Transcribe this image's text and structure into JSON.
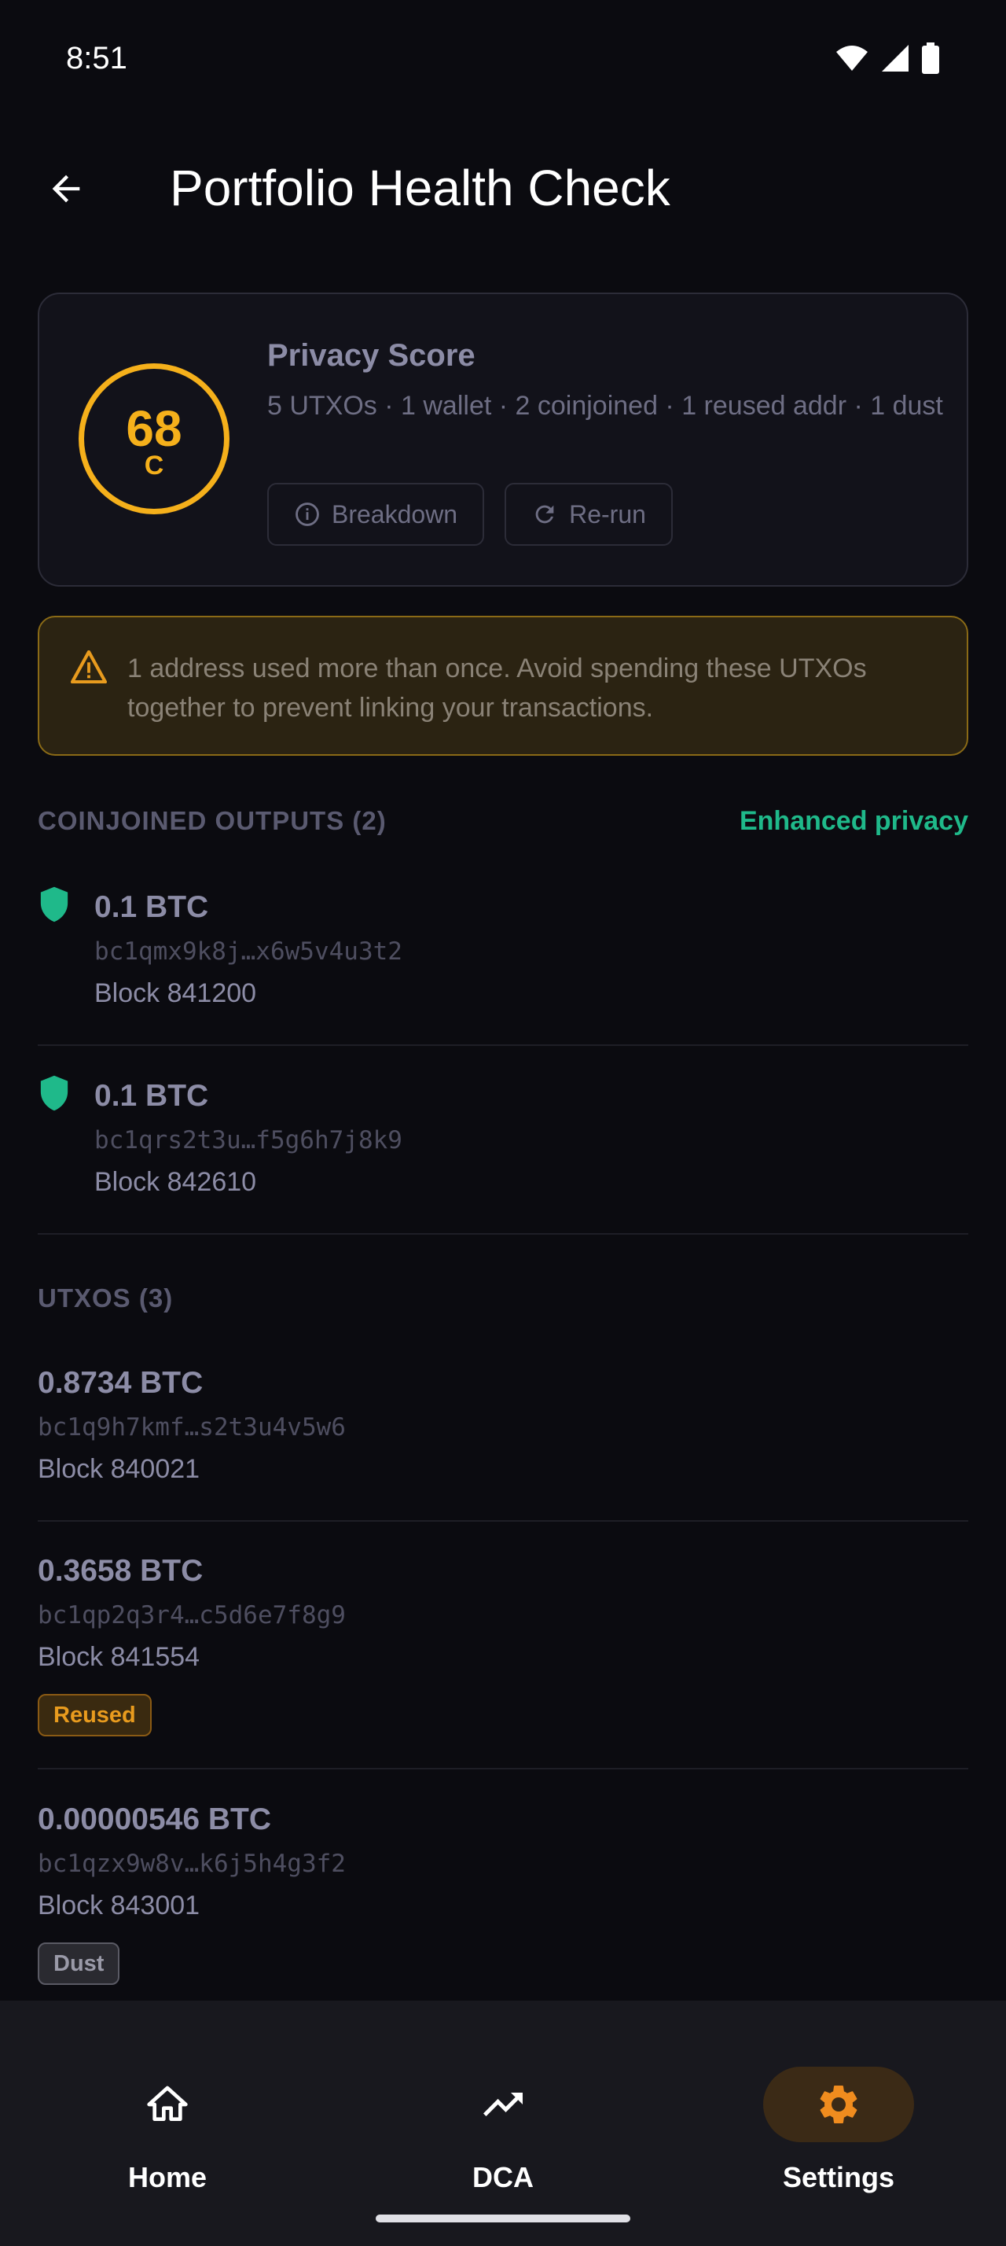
{
  "status_bar": {
    "time": "8:51"
  },
  "app_bar": {
    "title": "Portfolio Health Check"
  },
  "score_card": {
    "score": "68",
    "grade": "C",
    "title": "Privacy Score",
    "summary": "5 UTXOs · 1 wallet · 2 coinjoined · 1 reused addr · 1 dust",
    "breakdown_label": "Breakdown",
    "rerun_label": "Re-run"
  },
  "warning": {
    "text": "1 address used more than once. Avoid spending these UTXOs together to prevent linking your transactions."
  },
  "coinjoined": {
    "title": "COINJOINED OUTPUTS (2)",
    "right_label": "Enhanced privacy",
    "items": [
      {
        "amount": "0.1 BTC",
        "address": "bc1qmx9k8j…x6w5v4u3t2",
        "block": "Block 841200"
      },
      {
        "amount": "0.1 BTC",
        "address": "bc1qrs2t3u…f5g6h7j8k9",
        "block": "Block 842610"
      }
    ]
  },
  "utxos": {
    "title": "UTXOS (3)",
    "items": [
      {
        "amount": "0.8734 BTC",
        "address": "bc1q9h7kmf…s2t3u4v5w6",
        "block": "Block 840021",
        "badge": ""
      },
      {
        "amount": "0.3658 BTC",
        "address": "bc1qp2q3r4…c5d6e7f8g9",
        "block": "Block 841554",
        "badge": "Reused"
      },
      {
        "amount": "0.00000546 BTC",
        "address": "bc1qzx9w8v…k6j5h4g3f2",
        "block": "Block 843001",
        "badge": "Dust"
      }
    ]
  },
  "bottom_nav": {
    "items": [
      {
        "label": "Home",
        "icon": "home-icon"
      },
      {
        "label": "DCA",
        "icon": "trending-up-icon"
      },
      {
        "label": "Settings",
        "icon": "gear-icon",
        "active": true
      }
    ]
  },
  "colors": {
    "accent": "#f5b01b",
    "privacy_green": "#1fb98a",
    "warning_bg": "#2b2312"
  }
}
